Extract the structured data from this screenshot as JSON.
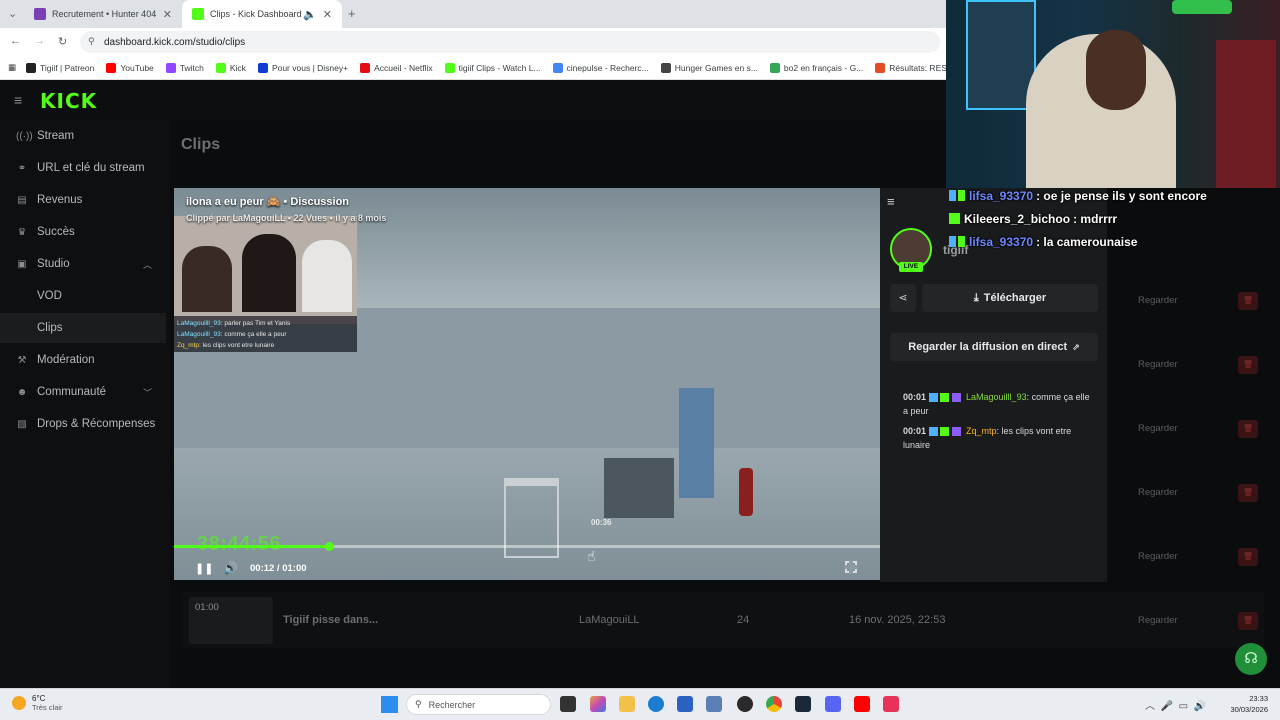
{
  "browser": {
    "tabs": [
      {
        "label": "Recrutement • Hunter 404",
        "color": "#7b3fb5"
      },
      {
        "label": "Clips - Kick Dashboard",
        "color": "#53fc18"
      }
    ],
    "url": "dashboard.kick.com/studio/clips",
    "bookmarks": [
      {
        "label": "Tigiif | Patreon",
        "color": "#222222"
      },
      {
        "label": "YouTube",
        "color": "#ff0000"
      },
      {
        "label": "Twitch",
        "color": "#9146ff"
      },
      {
        "label": "Kick",
        "color": "#53fc18"
      },
      {
        "label": "Pour vous | Disney+",
        "color": "#113ccf"
      },
      {
        "label": "Accueil - Netflix",
        "color": "#e50914"
      },
      {
        "label": "tigiif Clips - Watch L...",
        "color": "#53fc18"
      },
      {
        "label": "cinepulse - Recherc...",
        "color": "#4285f4"
      },
      {
        "label": "Hunger Games en s...",
        "color": "#444444"
      },
      {
        "label": "bo2 en français - G...",
        "color": "#34a853"
      },
      {
        "label": "Résultats: RESIDENT",
        "color": "#e44d26"
      }
    ]
  },
  "app": {
    "logo": "KICK",
    "page_title": "Clips",
    "nav": [
      {
        "label": "Stream",
        "icon": "broadcast-icon"
      },
      {
        "label": "URL et clé du stream",
        "icon": "link-icon"
      },
      {
        "label": "Revenus",
        "icon": "revenue-icon"
      },
      {
        "label": "Succès",
        "icon": "trophy-icon"
      },
      {
        "label": "Studio",
        "icon": "studio-icon"
      },
      {
        "label": "VOD",
        "icon": ""
      },
      {
        "label": "Clips",
        "icon": ""
      },
      {
        "label": "Modération",
        "icon": "moderation-icon"
      },
      {
        "label": "Communauté",
        "icon": "community-icon"
      },
      {
        "label": "Drops & Récompenses",
        "icon": "drops-icon"
      }
    ],
    "row_action": "Regarder"
  },
  "player": {
    "title": "ilona a eu peur 🙈 • Discussion",
    "subtitle": "Clippé par LaMagouiLL • 22 Vues • il y a 8 mois",
    "hover_time": "00:36",
    "overlay_time": "38:44:56",
    "timecode": "00:12 / 01:00",
    "progress": 0.22,
    "thumb_chat": [
      {
        "user": "LaMagouilll_93",
        "text": ": parler pas Tim et Yanis"
      },
      {
        "user": "LaMagouilll_93",
        "text": ": comme ça elle a peur"
      },
      {
        "user": "Zq_mtp",
        "text": ": les clips vont etre lunaire"
      }
    ]
  },
  "side": {
    "streamer": "tigiif",
    "live": "LIVE",
    "download": "Télécharger",
    "watch_live": "Regarder la diffusion en direct",
    "chat": [
      {
        "time": "00:01",
        "user": "LaMagouilll_93",
        "text": ": comme ça elle a peur"
      },
      {
        "time": "00:01",
        "user": "Zq_mtp",
        "text": ": les clips vont etre lunaire"
      }
    ]
  },
  "overlay_chat": [
    {
      "user": "lifsa_93370",
      "text": ": oe je pense ils y sont encore"
    },
    {
      "user": "Kileeers_2_bichoo",
      "text": ": mdrrrr"
    },
    {
      "user": "lifsa_93370",
      "text": ": la camerounaise"
    }
  ],
  "table_row": {
    "duration": "01:00",
    "title": "Tigiif pisse dans...",
    "author": "LaMagouiLL",
    "views": "24",
    "date": "16 nov. 2025, 22:53",
    "action": "Regarder"
  },
  "taskbar": {
    "weather_temp": "6°C",
    "weather_desc": "Très clair",
    "search_placeholder": "Rechercher",
    "time": "23:33",
    "date": "30/03/2026"
  }
}
